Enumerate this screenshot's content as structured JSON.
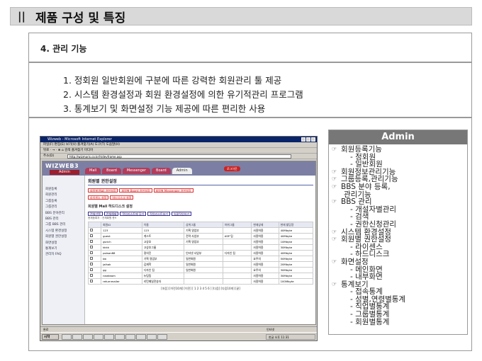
{
  "header": {
    "bars": "||",
    "title": "제품 구성 및 특징"
  },
  "section": {
    "title": "4. 관리 기능",
    "features": [
      "1. 정회원 일반회원에 구분에 따른 강력한 회원관리  툴 제공",
      "2. 시스템 환경설정과 회원 환경설정에 의한  유기적관리 프로그램",
      "3. 통계보기 및  화면설정 기능 제공에 따른 편리한 사용"
    ]
  },
  "screenshot": {
    "window_title": "Wizweb - Microsoft Internet Explorer",
    "menu": "파일(F)  편집(E)  보기(V)  즐겨찾기(A)  도구(T)  도움말(H)",
    "toolbar": "뒤로 · → · ⊗ ⌂  검색  즐겨찾기  미디어",
    "address_label": "주소(D)",
    "address": "http://wizmaris.co.kr/h/devframe.asp",
    "links_label": "연결",
    "links_item": "Wizweb",
    "logo": "WIZWEB3",
    "logo_sub": "Admin",
    "nav_tabs": [
      "Mall",
      "Board",
      "Messenger",
      "Board",
      "Admin"
    ],
    "logout": "로그아웃",
    "left_menu": [
      "회원등록",
      "회원관리",
      "그룹등록",
      "그룹관리",
      "BBS 분야관리",
      "BBS 관리",
      "그룹 BBS 관리",
      "시스템 환경설정",
      "회원별 권한설정",
      "화면설정",
      "통계보기",
      "관리자 FAQ"
    ],
    "page_title": "회원별 권한설정",
    "chips": [
      "회원별 Mall 권한설정",
      "회원별 Board 권한설정",
      "회원별 Messenger 권한설정"
    ],
    "chips2": [
      "라이센스 설정",
      "하드디스크 설정"
    ],
    "sub_title": "회원별 Mall 하드디스크 설정",
    "buttons": [
      "전체선택",
      "전체해제",
      "적업리스트에 담기",
      "작업리스트보기",
      "일괄작업하기"
    ],
    "hint": "현재등록자 : 전체회원 총9",
    "columns": [
      "",
      "회원ID",
      "이름",
      "상위그룹",
      "하위그룹",
      "현재상태",
      "현재 할당량"
    ],
    "rows": [
      [
        "",
        "123",
        "123",
        "기획 영업부",
        "",
        "사용허용",
        "40Mbyte"
      ],
      [
        "",
        "guest",
        "게스트",
        "전략 사업부",
        "ASP 팀",
        "사용허용",
        "40Mbyte"
      ],
      [
        "",
        "gsrich",
        "고상호",
        "기획 영업부",
        "",
        "사용허용",
        "10Mbyte"
      ],
      [
        "",
        "kkkk",
        "고상호그룹",
        "",
        "",
        "사용허용",
        "30Mbyte"
      ],
      [
        "",
        "poison88",
        "정의진",
        "인터넷 사업부",
        "디자인 팀",
        "사용허용",
        "40Mbyte"
      ],
      [
        "",
        "bb",
        "기획 영업부",
        "일반회원",
        "",
        "요주의",
        "50Mbyte"
      ],
      [
        "",
        "jaihak",
        "김재학",
        "일반회원",
        "",
        "사용허용",
        "20Mbyte"
      ],
      [
        "",
        "gg",
        "디자인 팀",
        "일반회원",
        "",
        "요주의",
        "30Mbyte"
      ],
      [
        "",
        "newteam",
        "뉴팀팀",
        "",
        "",
        "사용허용",
        "30Mbyte"
      ],
      [
        "",
        "returnmailer",
        "리턴메일전송자",
        "",
        "",
        "사용허용",
        "100Mbyte"
      ]
    ],
    "pager": "[처음] [이전10개] [이전] [ 1 2 3 4 5 6 ] [다음] [다음10개] [끝]",
    "status_left": "완료",
    "status_right": "인터넷",
    "start": "시작",
    "tray": "한글  오후 11:31"
  },
  "admin": {
    "title": "Admin",
    "items": [
      {
        "level": 0,
        "text": "회원등록기능"
      },
      {
        "level": 1,
        "text": "- 정회원"
      },
      {
        "level": 1,
        "text": "- 일반회원"
      },
      {
        "level": 0,
        "text": "회원정보관리기능"
      },
      {
        "level": 0,
        "text": "그룹등록,관리기능"
      },
      {
        "level": 0,
        "text": "BBS 분야 등록,"
      },
      {
        "level": 2,
        "text": "관리기능"
      },
      {
        "level": 0,
        "text": "BBS 관리"
      },
      {
        "level": 1,
        "text": "- 개설자별관리"
      },
      {
        "level": 1,
        "text": "- 검색"
      },
      {
        "level": 1,
        "text": "- 권한신청관리"
      },
      {
        "level": 0,
        "text": "시스템 환경설정"
      },
      {
        "level": 0,
        "text": "회원별 권한설정"
      },
      {
        "level": 1,
        "text": "- 라이센스"
      },
      {
        "level": 1,
        "text": "- 하드디스크"
      },
      {
        "level": 0,
        "text": "화면설정"
      },
      {
        "level": 1,
        "text": "- 메인화면"
      },
      {
        "level": 1,
        "text": "- 내부화면"
      },
      {
        "level": 0,
        "text": "통계보기"
      },
      {
        "level": 1,
        "text": "- 접속통계"
      },
      {
        "level": 1,
        "text": "- 성별,연령별통계"
      },
      {
        "level": 1,
        "text": "- 직업별통계"
      },
      {
        "level": 1,
        "text": "- 그룹별통계"
      },
      {
        "level": 1,
        "text": "- 회원별통계"
      }
    ]
  }
}
